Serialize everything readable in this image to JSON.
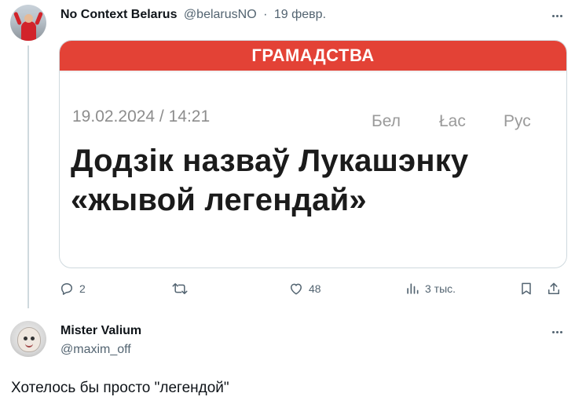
{
  "tweet": {
    "display_name": "No Context Belarus",
    "handle": "@belarusNO",
    "separator": "·",
    "date": "19 февр.",
    "card": {
      "section": "ГРАМАДСТВА",
      "datetime": "19.02.2024 / 14:21",
      "languages": [
        "Бел",
        "Łac",
        "Рус"
      ],
      "headline_line1": "Додзік назваў Лукашэнку",
      "headline_line2": "«жывой легендай»"
    },
    "actions": {
      "replies": "2",
      "reposts": "",
      "likes": "48",
      "views": "3 тыс."
    }
  },
  "reply": {
    "display_name": "Mister Valium",
    "handle": "@maxim_off",
    "text": "Хотелось бы просто \"легендой\""
  },
  "icons": {
    "reply": "comment-bubble-icon",
    "repost": "repost-arrows-icon",
    "like": "heart-icon",
    "views": "bar-chart-icon",
    "bookmark": "bookmark-icon",
    "share": "share-upload-icon",
    "more": "ellipsis-icon"
  },
  "colors": {
    "card_band": "#e34236",
    "text_secondary": "#536471",
    "border": "#cfd9de"
  }
}
